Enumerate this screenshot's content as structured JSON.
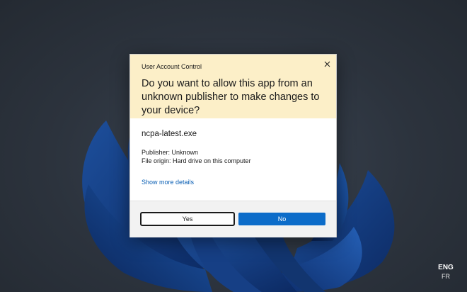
{
  "dialog": {
    "title": "User Account Control",
    "question": "Do you want to allow this app from an unknown publisher to make changes to your device?",
    "app_name": "ncpa-latest.exe",
    "publisher": "Publisher: Unknown",
    "file_origin": "File origin: Hard drive on this computer",
    "details_link": "Show more details",
    "yes_label": "Yes",
    "no_label": "No",
    "close_icon": "close-icon"
  },
  "system": {
    "language_primary": "ENG",
    "language_secondary": "FR"
  },
  "colors": {
    "header_background": "#fcefc8",
    "primary_button": "#0c6cc9",
    "link": "#0a5fb4",
    "desktop_background": "#2c333d"
  }
}
